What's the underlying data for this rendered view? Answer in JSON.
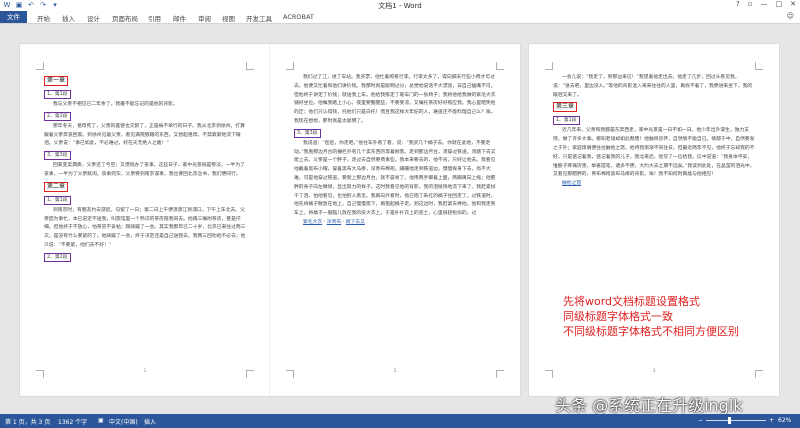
{
  "titlebar": {
    "title": "文档1 - Word",
    "help": "?",
    "restore": "▫",
    "minimize": "—",
    "maximize": "□",
    "close": "✕"
  },
  "ribbon": {
    "tabs": [
      "文件",
      "开始",
      "插入",
      "设计",
      "页面布局",
      "引用",
      "邮件",
      "审阅",
      "视图",
      "开发工具",
      "ACROBAT"
    ],
    "right_icon": "☺"
  },
  "page1": {
    "h_ch1": "第一章",
    "h_s1": "1、第1段",
    "p1": "我与父亲不相见已二年余了，我最不能忘记的是他的背影。",
    "h_s2": "2、第2段",
    "p2": "那年冬天，祖母死了，父亲的差使也交卸了，正是祸不单行的日子。我从北京到徐州，打算跟着父亲奔丧回家。到徐州见着父亲，看见满院狼藉的东西，又想起祖母，不禁簌簌地流下眼泪。父亲说：“事已如此，不必难过，好在天无绝人之路！”",
    "h_s3": "3、第3段",
    "p3": "回家变卖典质，父亲还了亏空；又借钱办了丧事。这些日子，家中光景很是惨淡，一半为了丧事，一半为了父亲赋闲。丧事完毕，父亲要到南京谋事，我也要回北京念书，我们便同行。",
    "h_ch2": "第二章",
    "h_s4": "1、第1段",
    "p4": "到南京时，有朋友约去游逛，勾留了一日；第二日上午便须渡江到浦口，下午上车北去。父亲因为事忙，本已说定不送我，叫旅馆里一个熟识的茶房陪我同去。他再三嘱咐茶房，甚是仔细。但他终于不放心，怕茶房不妥帖；颇踌躇了一会。其实我那年已二十岁，北京已来往过两三次，是没有什么要紧的了。他踌躇了一会，终于决定还是自己送我去。我两三回劝他不必去；他只说：“不要紧，他们去不好！”",
    "h_s5": "2、第2段",
    "pgnum": "1"
  },
  "page2": {
    "p1": "我们过了江，进了车站。我买票，他忙着照看行李。行李太多了，得向脚夫行些小费才可过去。他便又忙着和他们讲价钱。我那时真是聪明过分，总觉他说话不大漂亮，非自己插嘴不可。但他终于讲定了价钱；就送我上车。他给我拣定了靠车门的一张椅子；我将他给我做的紫毛大衣铺好坐位。他嘱我路上小心，夜里要警醒些，不要受凉。又嘱托茶房好好照应我。我心里暗笑他的迂；他们只认得钱，托他们只是白托！而且我这样大年纪的人，难道还不能料理自己么？唉，我现在想想，那时真是太聪明了。",
    "link1": "紫毛大衣",
    "h_s3": "3、第3段",
    "p2": "我说道：“爸爸，你走吧。”他往车外看了看，说：“我买几个橘子去。你就在此地，不要走动。”我看那边月台的栅栏外有几个卖东西的等着顾客。走到那边月台，须穿过铁道，须跳下去又爬上去。父亲是一个胖子，走过去自然要费事些。我本来要去的，他不肯，只好让他去。我看见他戴着黑布小帽，穿着黑布大马褂，深青布棉袍，蹒跚地走到铁道边，慢慢探身下去，尚不大难。可是他穿过铁道，要爬上那边月台，就不容易了。他用两手攀着上面，两脚再向上缩；他肥胖的身子向左微倾，显出努力的样子。这时我看见他的背影，我的泪很快地流下来了。我赶紧拭干了泪，怕他看见，也怕别人看见。我再向外看时，他已抱了朱红的橘子往回走了。过铁道时，他先将橘子散放在地上，自己慢慢爬下，再抱起橘子走。到这边时，我赶紧去搀他。他和我走到车上，将橘子一股脑儿放在我的皮大衣上。于是扑扑衣上的泥土，心里很轻松似的，过",
    "link2": "深青布",
    "link3": "跳下去又",
    "pgnum": "2"
  },
  "page3": {
    "p1": "一会儿说：“我走了，到那边来信！”我望着他走出去。他走了几步，回过头看见我，说：“进去吧，里边没人。”等他的背影混入来来往往的人里，再找不着了，我便进来坐下，我的眼泪又来了。",
    "h_ch3": "第三章",
    "h_s1": "1、第1段",
    "p2": "近几年来，父亲和我都是东奔西走，家中光景是一日不如一日。他少年出外谋生，独力支持，做了许多大事。哪知老境却如此颓唐！他触目伤怀，自然情不能自已。情郁于中，自然要发之于外；家庭琐屑便往往触他之怒。他待我渐渐不同往日。但最近两年不见，他终于忘却我的不好，只是惦记着我，惦记着我的儿子。我北来后，他写了一信给我，信中说道：“我身体平安，惟膀子疼痛厉害，举箸提笔，诸多不便，大约大去之期不远矣。”我读到此处，在晶莹的泪光中，又看见那肥胖的，青布棉袍黑布马褂的背影。唉！我不知何时再能与他相见！",
    "link1": "触他之怒",
    "pgnum": "3"
  },
  "annotation": {
    "line1": "先将word文档标题设置格式",
    "line2": "同级标题字体格式一致",
    "line3": "不同级标题字体格式不相同方便区别"
  },
  "watermark": "头条 @系统正在升级inglk",
  "statusbar": {
    "page": "第 1 页，共 3 页",
    "words": "1362 个字",
    "lang_icon": "▣",
    "lang": "中文(中国)",
    "mode": "插入",
    "zoom_out": "−",
    "zoom_in": "+",
    "zoom": "62%"
  },
  "colors": {
    "brand": "#2b579a",
    "heading1_border": "#e02020",
    "heading2_border": "#7030a0",
    "annotation": "#e02020"
  }
}
